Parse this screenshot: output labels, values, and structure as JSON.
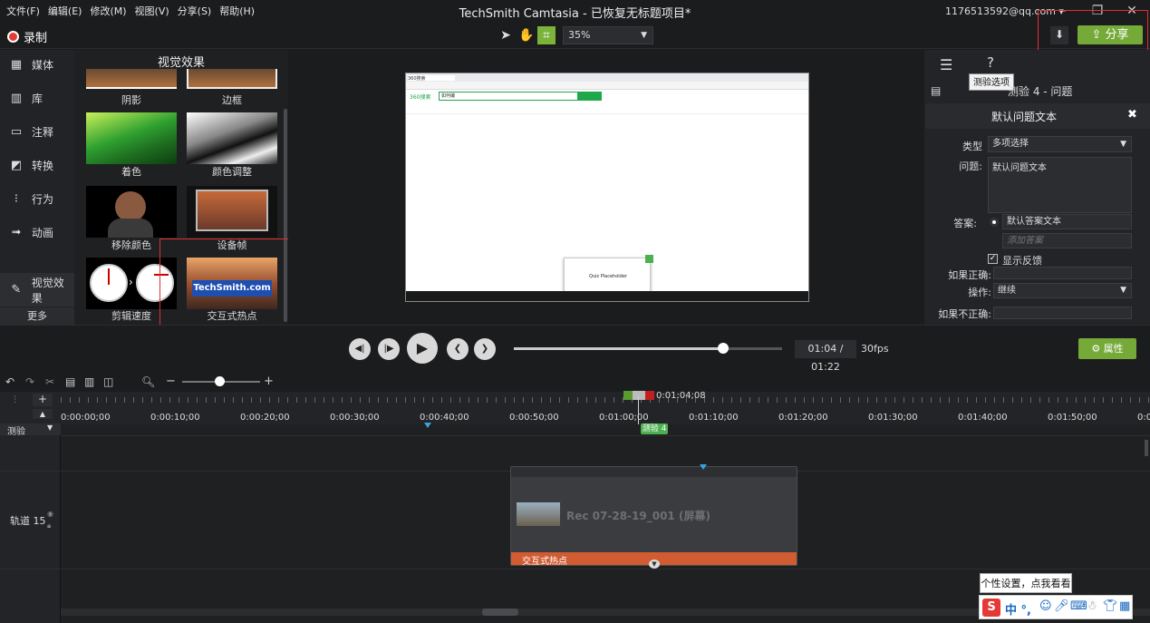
{
  "menu": [
    "文件(F)",
    "编辑(E)",
    "修改(M)",
    "视图(V)",
    "分享(S)",
    "帮助(H)"
  ],
  "window_title": "TechSmith Camtasia - 已恢复无标题项目*",
  "account": "1176513592@qq.com ▾",
  "record_label": "录制",
  "zoom_level": "35%",
  "share_label": "分享",
  "nav": [
    {
      "label": "媒体",
      "icon": "media-icon"
    },
    {
      "label": "库",
      "icon": "library-icon"
    },
    {
      "label": "注释",
      "icon": "annotation-icon"
    },
    {
      "label": "转换",
      "icon": "transition-icon"
    },
    {
      "label": "行为",
      "icon": "behavior-icon"
    },
    {
      "label": "动画",
      "icon": "animation-icon"
    },
    {
      "label": "视觉效果",
      "icon": "visual-effects-icon"
    }
  ],
  "more_label": "更多",
  "effects_title": "视觉效果",
  "effects": [
    "阴影",
    "边框",
    "着色",
    "颜色调整",
    "移除颜色",
    "设备帧",
    "剪辑速度",
    "交互式热点"
  ],
  "hotspot_thumb_text": "TechSmith.com",
  "props": {
    "tooltip": "测验选项",
    "quiz_title": "测验 4 - 问题",
    "question_header": "默认问题文本",
    "type_label": "类型",
    "type_value": "多项选择",
    "question_label": "问题:",
    "question_value": "默认问题文本",
    "answer_label": "答案:",
    "answer_value": "默认答案文本",
    "add_answer_placeholder": "添加答案",
    "show_feedback": "显示反馈",
    "if_correct": "如果正确:",
    "action_label": "操作:",
    "action_value": "继续",
    "if_incorrect": "如果不正确:"
  },
  "playback": {
    "timecode": "01:04 / 01:22",
    "fps": "30fps",
    "progress": 0.78
  },
  "properties_button": "属性",
  "ruler_ticks": [
    "0:00:00;00",
    "0:00:10;00",
    "0:00:20;00",
    "0:00:30;00",
    "0:00:40;00",
    "0:00:50;00",
    "0:01:00;00",
    "0:01:10;00",
    "0:01:20;00",
    "0:01:30;00",
    "0:01:40;00",
    "0:01:50;00",
    "0:0"
  ],
  "playhead_time": "0:01:04;08",
  "quiz_track_label": "测验",
  "quiz_marker": "测验 4",
  "track_label": "轨道 15",
  "clip_name": "Rec 07-28-19_001 (屏幕)",
  "clip_effect": "交互式热点",
  "ime_tooltip": "个性设置，点我看看",
  "ime_chars": "中 °,",
  "screen": {
    "tab": "360搜索",
    "search_text": "如何编",
    "placeholder_title": "Quiz Placeholder"
  }
}
